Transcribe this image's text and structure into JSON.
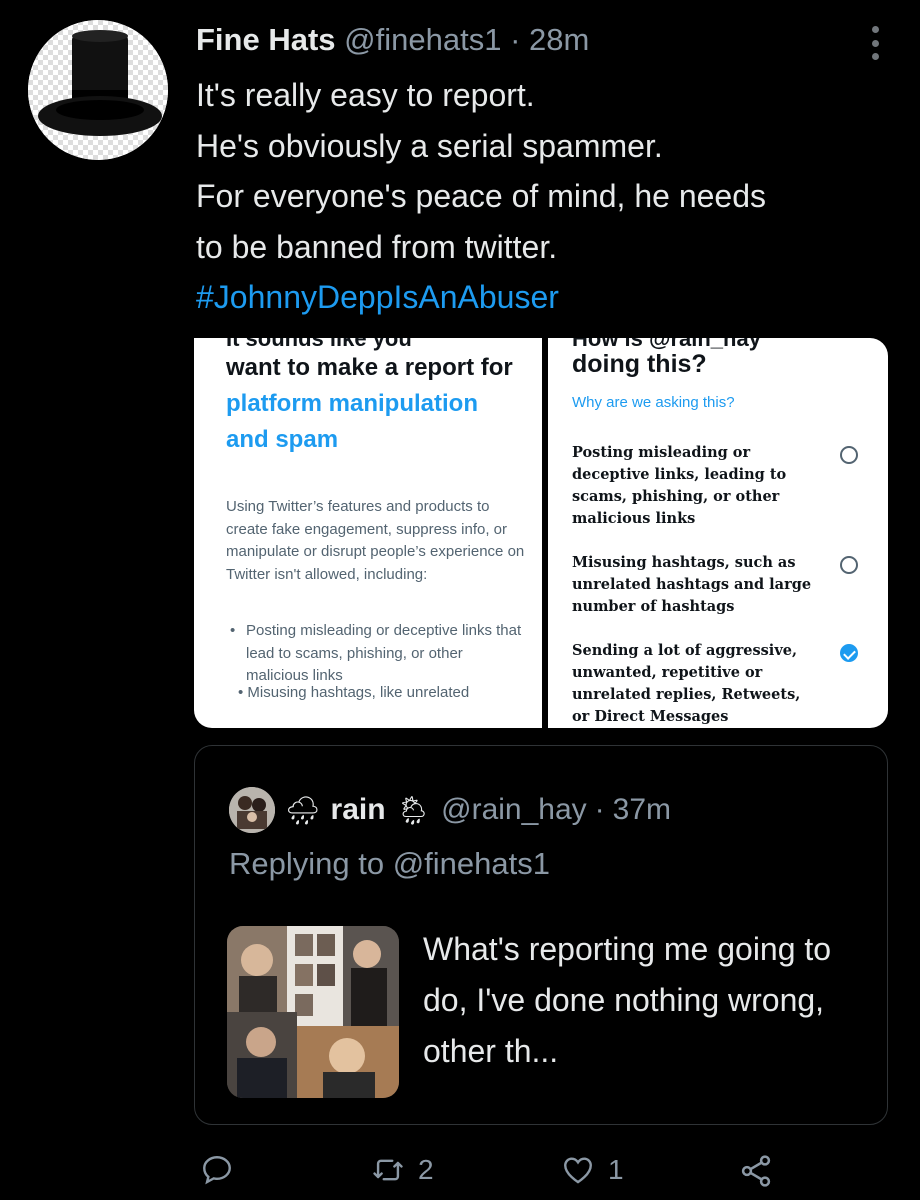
{
  "tweet": {
    "author_name": "Fine Hats",
    "author_handle": "@finehats1",
    "separator": "·",
    "time": "28m",
    "lines": [
      "It's really easy to report.",
      "He's obviously a serial spammer.",
      "For everyone's peace of mind, he needs",
      "to be banned from twitter."
    ],
    "hashtag": "#JohnnyDeppIsAnAbuser"
  },
  "media": {
    "left": {
      "cut_top": "It sounds like you",
      "title_plain": "want to make a report for",
      "title_blue": "platform manipulation and spam",
      "description": "Using Twitter’s features and products to create fake engagement, suppress info, or manipulate or disrupt people’s experience on Twitter isn't allowed, including:",
      "bullet": "Posting misleading or deceptive links that lead to scams, phishing, or other malicious links",
      "bullet_cut": "• Misusing hashtags, like unrelated"
    },
    "right": {
      "cut_top": "How is @rain_hay",
      "title": "doing this?",
      "why": "Why are we asking this?",
      "options": [
        {
          "label": "Posting misleading or deceptive links, leading to scams, phishing, or other malicious links",
          "checked": false
        },
        {
          "label": "Misusing hashtags, such as unrelated hashtags and large number of hashtags",
          "checked": false
        },
        {
          "label": "Sending a lot of aggressive, unwanted, repetitive or unrelated replies, Retweets, or Direct Messages",
          "checked": true
        }
      ]
    }
  },
  "quote": {
    "emoji_before": "🌧",
    "name": "rain",
    "emoji_after": "🌦",
    "handle": "@rain_hay",
    "separator": "·",
    "time": "37m",
    "replying_to": "Replying to @finehats1",
    "text": "What's reporting me going to do, I've done nothing wrong, other th..."
  },
  "actions": {
    "retweets": "2",
    "likes": "1"
  },
  "icons": [
    "more-icon",
    "reply-icon",
    "retweet-icon",
    "like-icon",
    "share-icon"
  ],
  "colors": {
    "accent": "#1d9bf0",
    "background": "#000000",
    "muted": "#8b98a5"
  }
}
